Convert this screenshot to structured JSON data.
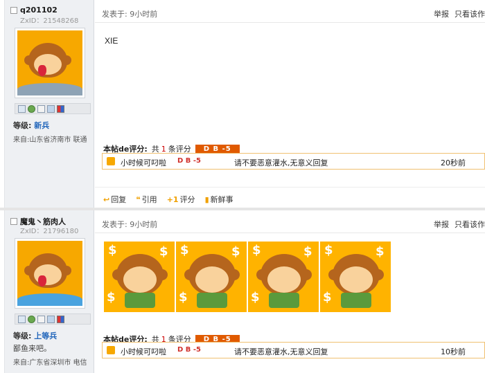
{
  "posts": [
    {
      "username": "q201102",
      "zxid": "ZxID：21548268",
      "level_label": "等级:",
      "level_value": "新兵",
      "signature": "",
      "from": "来自:山东省济南市 联通",
      "posted": "发表于: 9小时前",
      "ops": {
        "report": "举报",
        "only_author": "只看该作"
      },
      "content": "XIE",
      "rating": {
        "title": "本帖de评分:",
        "count_prefix": "共",
        "count": "1",
        "count_suffix": "条评分",
        "badge": "D B -5",
        "row": {
          "user": "小时候可叼啦",
          "score": "D B -5",
          "reason": "请不要恶意灌水,无意义回复",
          "time": "20秒前"
        }
      },
      "actions": [
        {
          "icon": "reply-icon",
          "glyph": "↩",
          "label": "回复"
        },
        {
          "icon": "quote-icon",
          "glyph": "❝",
          "label": "引用"
        },
        {
          "icon": "rate-icon",
          "glyph": "+1",
          "label": "评分"
        },
        {
          "icon": "fresh-icon",
          "glyph": "▮",
          "label": "新鲜事"
        }
      ]
    },
    {
      "username": "魔鬼丶筋肉人",
      "zxid": "ZxID：21796180",
      "level_label": "等级:",
      "level_value": "上等兵",
      "signature": "鄙鱼来吧。",
      "from": "来自:广东省深圳市 电信",
      "posted": "发表于: 9小时前",
      "ops": {
        "report": "举报",
        "only_author": "只看该作"
      },
      "rating": {
        "title": "本帖de评分:",
        "count_prefix": "共",
        "count": "1",
        "count_suffix": "条评分",
        "badge": "D B -5",
        "row": {
          "user": "小时候可叼啦",
          "score": "D B -5",
          "reason": "请不要恶意灌水,无意义回复",
          "time": "10秒前"
        }
      }
    }
  ],
  "colors": {
    "accent": "#e05a00",
    "level": "#2266bb",
    "rating_border": "#f0c070",
    "sidebar": "#eef0f3"
  }
}
